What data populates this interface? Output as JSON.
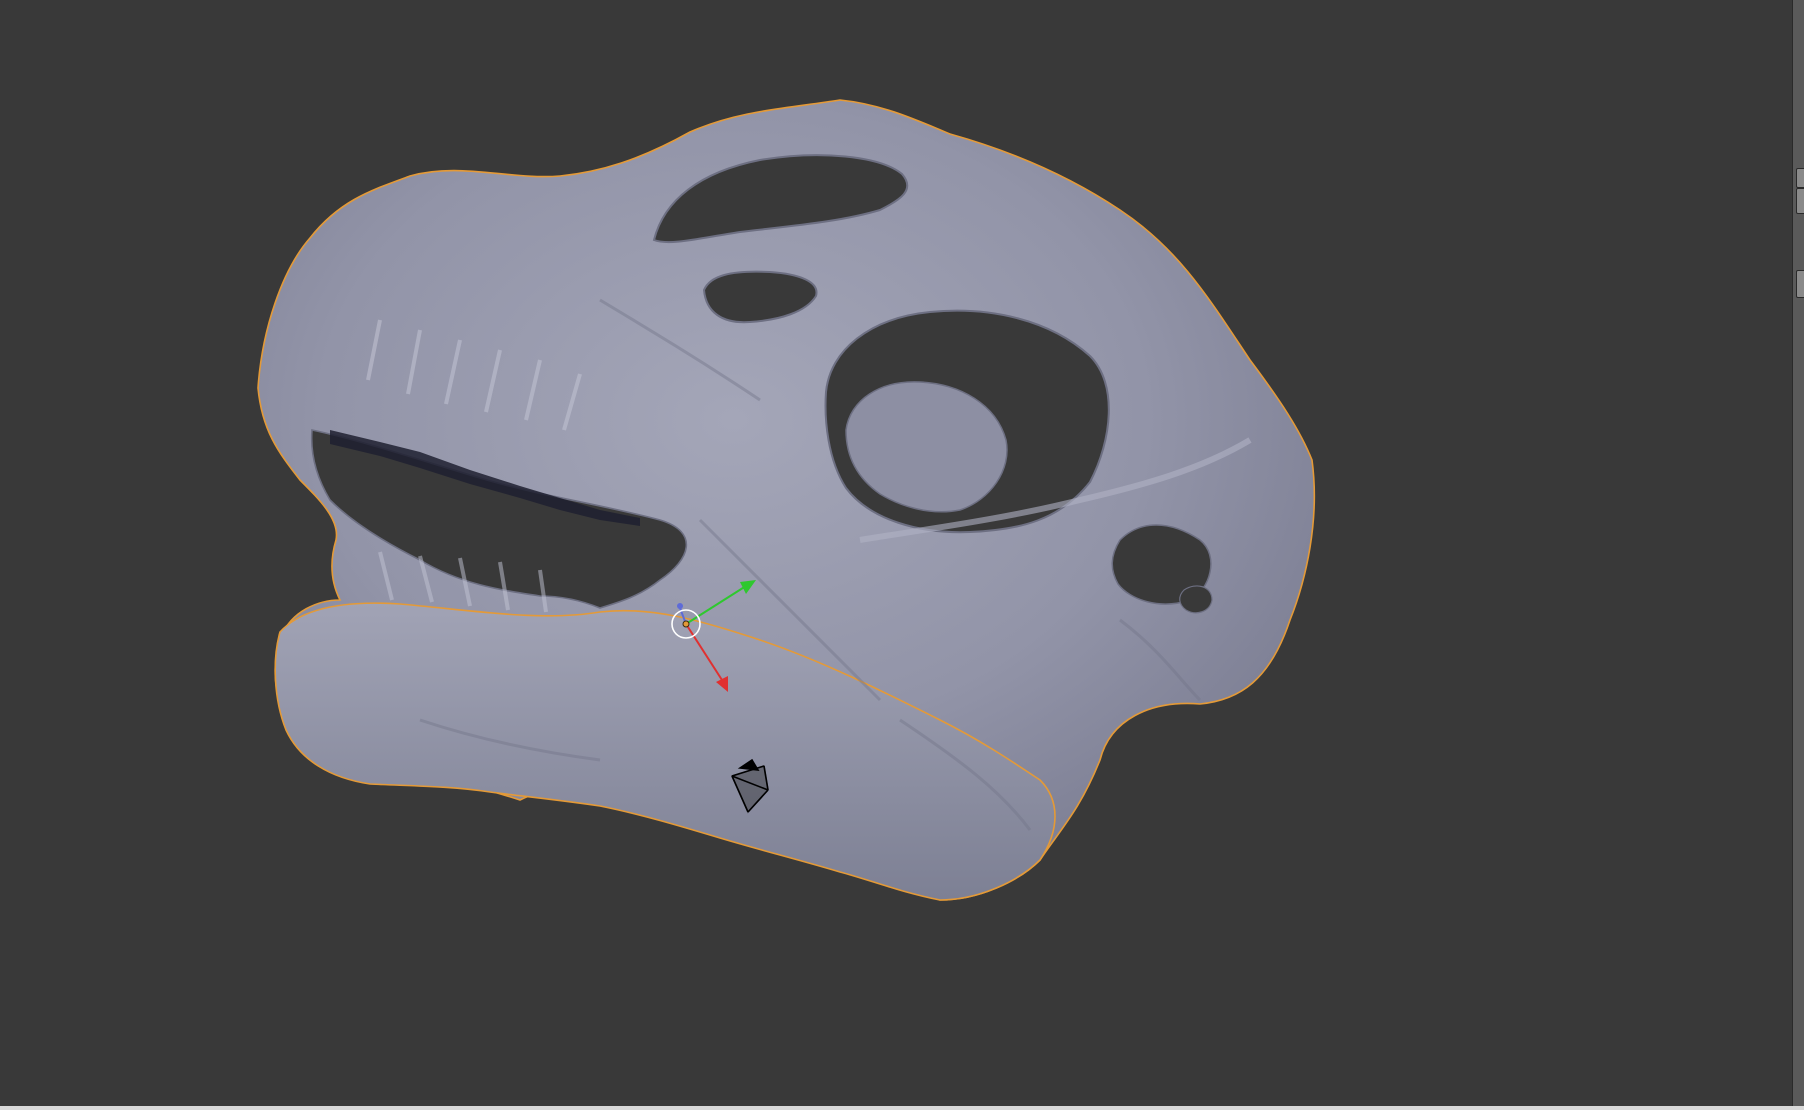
{
  "viewport": {
    "background_color": "#393939",
    "object": {
      "name": "dinosaur-skull-mesh",
      "selected": true,
      "mesh_color": "#9ea0b3",
      "outline_color": "#e49a37"
    },
    "gizmo": {
      "x_axis_color": "#e03030",
      "y_axis_color": "#2ec82e",
      "z_axis_color": "#5e6bd8"
    },
    "grid_color": "#4d4d4d",
    "camera_icon": "camera-object-icon"
  },
  "edge_widgets": [
    "area-split-widget-top",
    "area-split-widget-bottom"
  ]
}
